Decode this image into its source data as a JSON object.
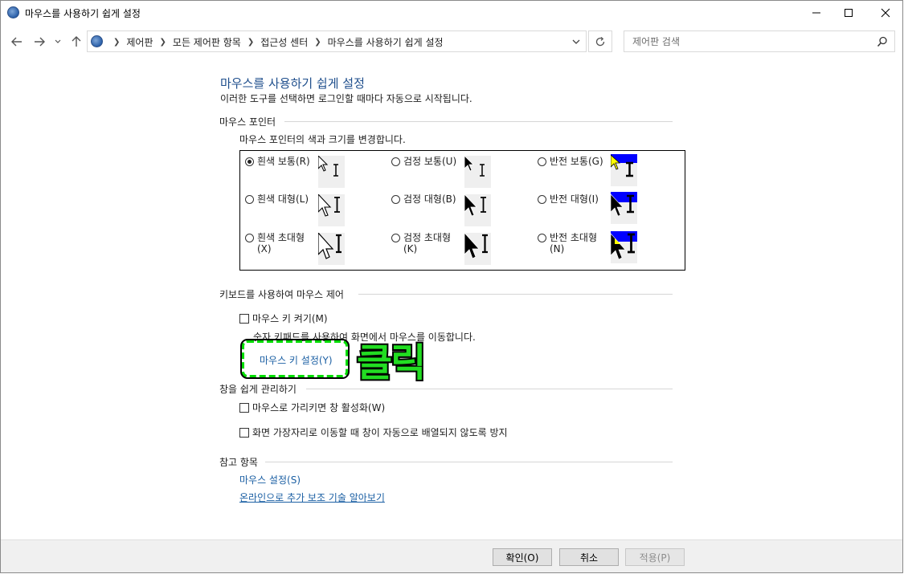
{
  "window": {
    "title": "마우스를 사용하기 쉽게 설정"
  },
  "nav": {
    "breadcrumbs": [
      "제어판",
      "모든 제어판 항목",
      "접근성 센터",
      "마우스를 사용하기 쉽게 설정"
    ],
    "search_placeholder": "제어판 검색"
  },
  "main": {
    "title": "마우스를 사용하기 쉽게 설정",
    "subtitle": "이러한 도구를 선택하면 로그인할 때마다 자동으로 시작됩니다.",
    "pointer_section": {
      "heading": "마우스 포인터",
      "description": "마우스 포인터의 색과 크기를 변경합니다.",
      "options": [
        {
          "label": "흰색 보통(R)",
          "label2": "",
          "checked": true
        },
        {
          "label": "검정 보통(U)",
          "label2": "",
          "checked": false
        },
        {
          "label": "반전 보통(G)",
          "label2": "",
          "checked": false
        },
        {
          "label": "흰색 대형(L)",
          "label2": "",
          "checked": false
        },
        {
          "label": "검정 대형(B)",
          "label2": "",
          "checked": false
        },
        {
          "label": "반전 대형(I)",
          "label2": "",
          "checked": false
        },
        {
          "label": "흰색 초대형",
          "label2": "(X)",
          "checked": false
        },
        {
          "label": "검정 초대형",
          "label2": "(K)",
          "checked": false
        },
        {
          "label": "반전 초대형",
          "label2": "(N)",
          "checked": false
        }
      ]
    },
    "keyboard_section": {
      "heading": "키보드를 사용하여 마우스 제어",
      "mouse_keys_label": "마우스 키 켜기(M)",
      "mouse_keys_checked": false,
      "mouse_keys_desc": "숫자 키패드를 사용하여 화면에서 마우스를 이동합니다.",
      "settings_link": "마우스 키 설정(Y)"
    },
    "annotation": "클릭",
    "window_section": {
      "heading": "창을 쉽게 관리하기",
      "hover_activate_label": "마우스로 가리키면 창 활성화(W)",
      "hover_activate_checked": false,
      "prevent_arrange_label": "화면 가장자리로 이동할 때 창이 자동으로 배열되지 않도록 방지",
      "prevent_arrange_checked": false
    },
    "see_also": {
      "heading": "참고 항목",
      "links": [
        "마우스 설정(S)",
        "온라인으로 추가 보조 기술 알아보기"
      ]
    }
  },
  "footer": {
    "ok": "확인(O)",
    "cancel": "취소",
    "apply": "적용(P)"
  },
  "colors": {
    "heading_blue": "#1e4e8c",
    "link_blue": "#1b5fa3",
    "annotation_green": "#22dd22",
    "inverted_pointer_bg": "#0000ff"
  }
}
